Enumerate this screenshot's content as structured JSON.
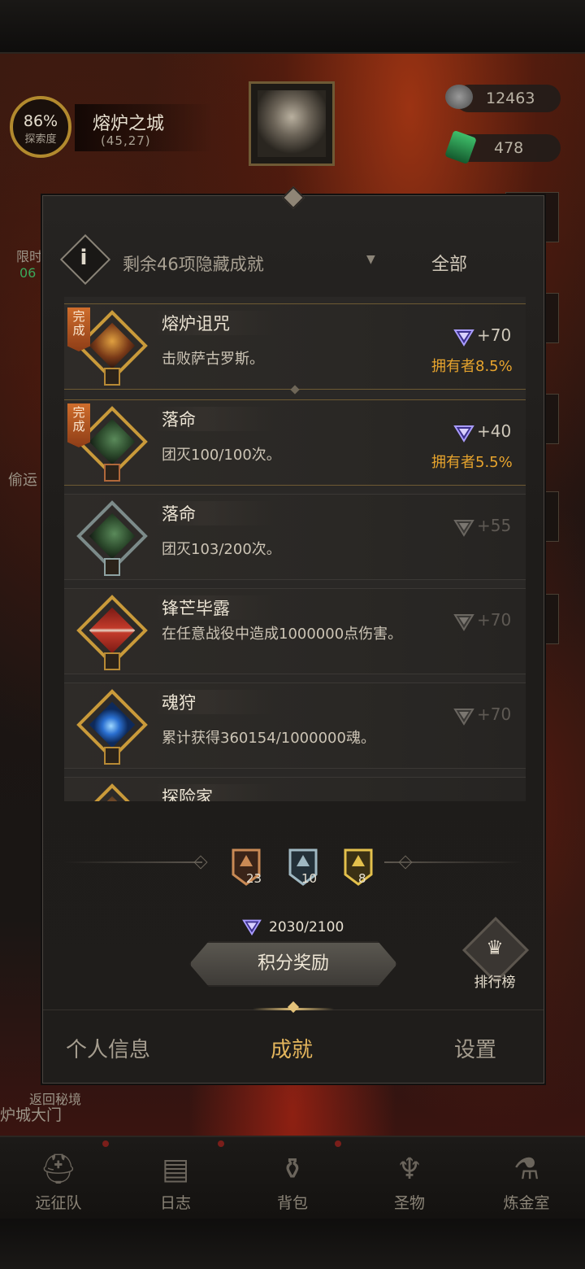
{
  "hud": {
    "explore_pct": "86%",
    "explore_label": "探索度",
    "location_name": "熔炉之城",
    "location_coord": "(45,27)",
    "currency_1": "12463",
    "currency_2": "478",
    "left_timer_label": "限时",
    "left_timer_value": "06",
    "left_side_label": "偷运",
    "return_label": "返回秘境",
    "gate_label": "炉城大门"
  },
  "dialog": {
    "filter_text": "剩余46项隐藏成就",
    "filter_all": "全部",
    "achievements": [
      {
        "name": "熔炉诅咒",
        "desc": "击败萨古罗斯。",
        "points": "+70",
        "owners": "拥有者8.5%",
        "complete_tag": "完成",
        "state": "done"
      },
      {
        "name": "落命",
        "desc": "团灭100/100次。",
        "points": "+40",
        "owners": "拥有者5.5%",
        "complete_tag": "完成",
        "state": "done"
      },
      {
        "name": "落命",
        "desc": "团灭103/200次。",
        "points": "+55",
        "owners": "",
        "complete_tag": "",
        "state": "pending"
      },
      {
        "name": "锋芒毕露",
        "desc": "在任意战役中造成1000000点伤害。",
        "points": "+70",
        "owners": "",
        "complete_tag": "",
        "state": "pending"
      },
      {
        "name": "魂狩",
        "desc": "累计获得360154/1000000魂。",
        "points": "+70",
        "owners": "",
        "complete_tag": "",
        "state": "pending"
      },
      {
        "name": "探险家",
        "desc": "",
        "points": "",
        "owners": "",
        "complete_tag": "",
        "state": "pending"
      }
    ],
    "tiers": [
      {
        "count": "23",
        "color": "#c98a55"
      },
      {
        "count": "10",
        "color": "#9fb8c2"
      },
      {
        "count": "8",
        "color": "#e3c04c"
      }
    ],
    "score": "2030/2100",
    "reward_button": "积分奖励",
    "rank_button": "排行榜",
    "tabs": [
      "个人信息",
      "成就",
      "设置"
    ]
  },
  "bottom_nav": [
    {
      "label": "远征队",
      "icon": "helmet-icon"
    },
    {
      "label": "日志",
      "icon": "map-icon"
    },
    {
      "label": "背包",
      "icon": "bag-icon"
    },
    {
      "label": "圣物",
      "icon": "chalice-icon"
    },
    {
      "label": "炼金室",
      "icon": "alchemy-icon"
    }
  ],
  "colors": {
    "accent_gold": "#e3b55c",
    "owners_orange": "#e7a42d",
    "complete_tag": "#cf6d2c"
  }
}
